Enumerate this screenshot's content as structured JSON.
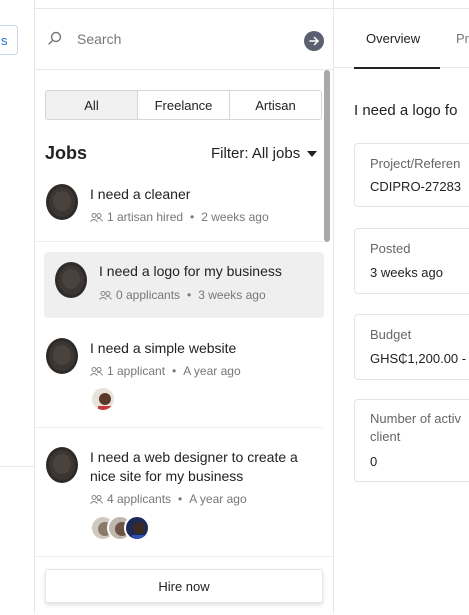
{
  "left_panel": {
    "chip_label": "s"
  },
  "search": {
    "placeholder": "Search",
    "value": ""
  },
  "segments": [
    {
      "label": "All",
      "active": true
    },
    {
      "label": "Freelance",
      "active": false
    },
    {
      "label": "Artisan",
      "active": false
    }
  ],
  "jobs_header": {
    "title": "Jobs",
    "filter_label": "Filter: All jobs"
  },
  "jobs": [
    {
      "title": "I need a cleaner",
      "meta": "1 artisan hired",
      "age": "2 weeks ago",
      "selected": false,
      "applicant_avatars": 0
    },
    {
      "title": "I need a logo for my business",
      "meta": "0 applicants",
      "age": "3 weeks ago",
      "selected": true,
      "applicant_avatars": 0
    },
    {
      "title": "I need a simple website",
      "meta": "1 applicant",
      "age": "A year ago",
      "selected": false,
      "applicant_avatars": 1
    },
    {
      "title": "I need a web designer to create a nice site for my business",
      "meta": "4 applicants",
      "age": "A year ago",
      "selected": false,
      "applicant_avatars": 3
    }
  ],
  "hire_button": {
    "label": "Hire now"
  },
  "detail_tabs": [
    {
      "label": "Overview",
      "active": true
    },
    {
      "label": "Pr",
      "active": false
    }
  ],
  "detail": {
    "title": "I need a logo fo",
    "cards": [
      {
        "label": "Project/Referen",
        "value": "CDIPRO-27283"
      },
      {
        "label": "Posted",
        "value": "3 weeks ago"
      },
      {
        "label": "Budget",
        "value": "GHS₵1,200.00 -"
      },
      {
        "label": "Number of activ client",
        "value": "0"
      }
    ]
  },
  "colors": {
    "selected_row": "#efefef",
    "accent_link": "#1a6fd0",
    "search_button": "#5b6070"
  }
}
